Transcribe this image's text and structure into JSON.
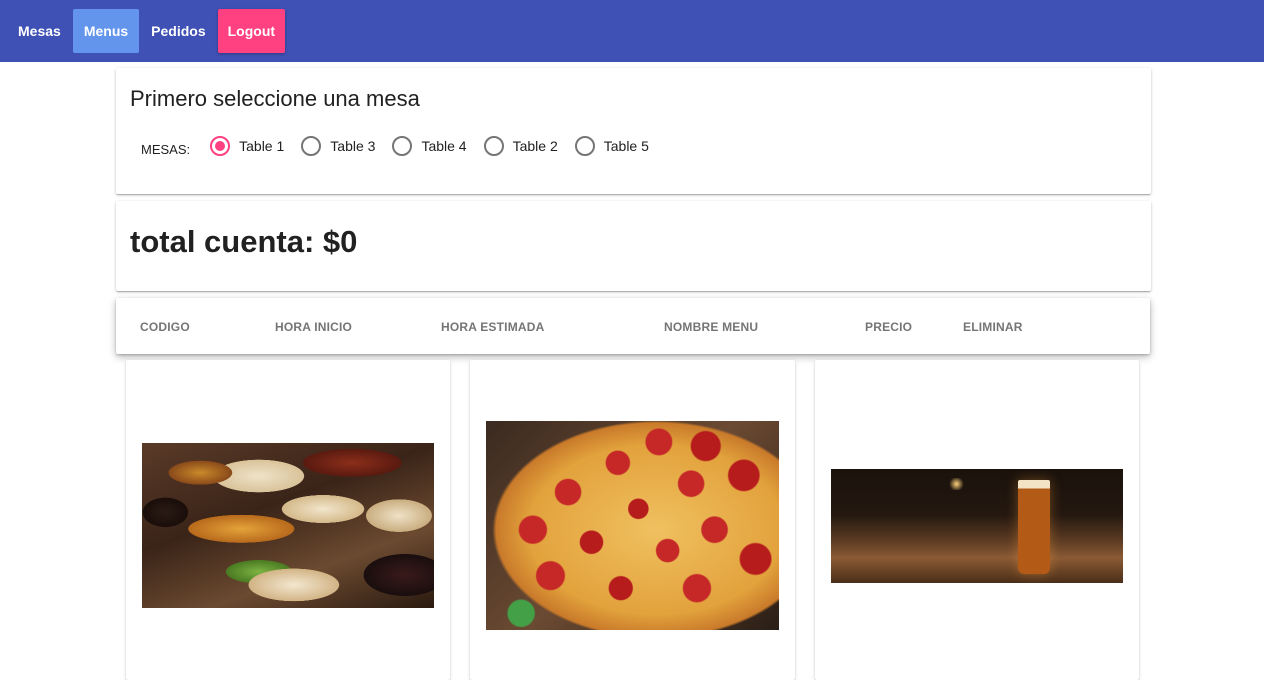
{
  "nav": {
    "items": [
      {
        "label": "Mesas"
      },
      {
        "label": "Menus",
        "active": true
      },
      {
        "label": "Pedidos"
      },
      {
        "label": "Logout"
      }
    ],
    "bar_color": "#3f51b5",
    "active_color": "#6495ed",
    "logout_color": "#ff4081"
  },
  "table_select": {
    "title": "Primero seleccione una mesa",
    "group_label": "MESAS:",
    "options": [
      {
        "label": "Table 1",
        "checked": true
      },
      {
        "label": "Table 3",
        "checked": false
      },
      {
        "label": "Table 4",
        "checked": false
      },
      {
        "label": "Table 2",
        "checked": false
      },
      {
        "label": "Table 5",
        "checked": false
      }
    ],
    "accent_color": "#ff4081"
  },
  "total": {
    "text": "total cuenta: $0"
  },
  "orders_table": {
    "columns": [
      "CODIGO",
      "HORA INICIO",
      "HORA ESTIMADA",
      "NOMBRE MENU",
      "PRECIO",
      "ELIMINAR"
    ],
    "rows": []
  },
  "menu_cards": [
    {
      "image": "arepas-photo"
    },
    {
      "image": "pizza-photo"
    },
    {
      "image": "beer-photo"
    }
  ]
}
